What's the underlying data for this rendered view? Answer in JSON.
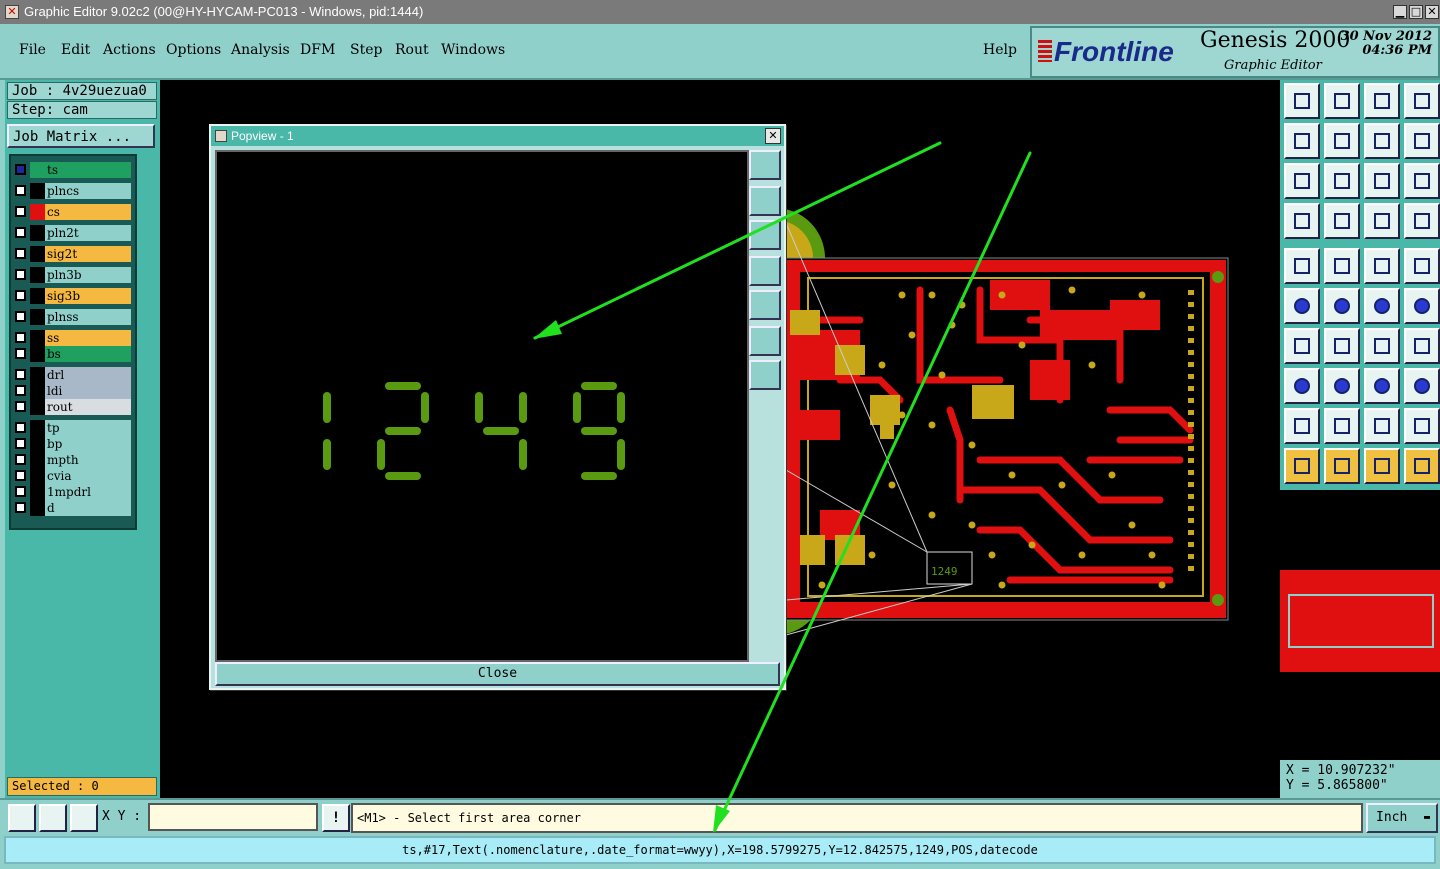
{
  "window": {
    "title": "Graphic Editor 9.02c2 (00@HY-HYCAM-PC013 - Windows, pid:1444)",
    "min_glyph": "▁",
    "max_glyph": "□",
    "close_glyph": "✕"
  },
  "menu": {
    "items": [
      "File",
      "Edit",
      "Actions",
      "Options",
      "Analysis",
      "DFM",
      "Step",
      "Rout",
      "Windows"
    ],
    "help": "Help"
  },
  "brand": {
    "logo": "Frontline",
    "product": "Genesis 2000",
    "subtitle": "Graphic Editor",
    "date": "30 Nov 2012",
    "time": "04:36 PM"
  },
  "job": {
    "job_label": "Job : 4v29uezua0",
    "step_label": "Step: cam",
    "matrix_button": "Job Matrix ..."
  },
  "layers": [
    {
      "name": "ts",
      "color": "#20a060",
      "swatch": "#20a060",
      "active": true
    },
    {
      "name": "plncs",
      "color": "#8fd0cb",
      "swatch": "#000000"
    },
    {
      "name": "cs",
      "color": "#f5b840",
      "swatch": "#e01010"
    },
    {
      "name": "pln2t",
      "color": "#8fd0cb",
      "swatch": "#000000"
    },
    {
      "name": "sig2t",
      "color": "#f5b840",
      "swatch": "#000000"
    },
    {
      "name": "pln3b",
      "color": "#8fd0cb",
      "swatch": "#000000"
    },
    {
      "name": "sig3b",
      "color": "#f5b840",
      "swatch": "#000000"
    },
    {
      "name": "plnss",
      "color": "#8fd0cb",
      "swatch": "#000000"
    },
    {
      "name": "ss",
      "color": "#f5b840",
      "swatch": "#000000"
    },
    {
      "name": "bs",
      "color": "#20a060",
      "swatch": "#000000"
    },
    {
      "name": "drl",
      "color": "#a8b8c8",
      "swatch": "#000000"
    },
    {
      "name": "ldi",
      "color": "#a8b8c8",
      "swatch": "#000000"
    },
    {
      "name": "rout",
      "color": "#d8dde2",
      "swatch": "#000000"
    },
    {
      "name": "tp",
      "color": "#8fd0cb",
      "swatch": "#000000"
    },
    {
      "name": "bp",
      "color": "#8fd0cb",
      "swatch": "#000000"
    },
    {
      "name": "mpth",
      "color": "#8fd0cb",
      "swatch": "#000000"
    },
    {
      "name": "cvia",
      "color": "#8fd0cb",
      "swatch": "#000000"
    },
    {
      "name": "1mpdrl",
      "color": "#8fd0cb",
      "swatch": "#000000"
    },
    {
      "name": "d",
      "color": "#8fd0cb",
      "swatch": "#000000"
    }
  ],
  "selected_label": "Selected : 0",
  "popview": {
    "title": "Popview - 1",
    "close_glyph": "✕",
    "close_button": "Close",
    "digits": "1249"
  },
  "board_label": "1249",
  "coords": {
    "x": "X = 10.907232\"",
    "y": "Y = 5.865800\""
  },
  "status": {
    "xy_label": "X Y :",
    "xy_value": "",
    "warn_glyph": "!",
    "prompt": "<M1> - Select first area corner",
    "unit": "Inch",
    "info": "ts,#17,Text(.nomenclature,.date_format=wwyy),X=198.5799275,Y=12.842575,1249,POS,datecode"
  },
  "colors": {
    "accent": "#8fd0cb",
    "board_red": "#e01010",
    "pad_gold": "#c8a818",
    "silk_green": "#5a9a10",
    "arrow_green": "#20e020"
  }
}
